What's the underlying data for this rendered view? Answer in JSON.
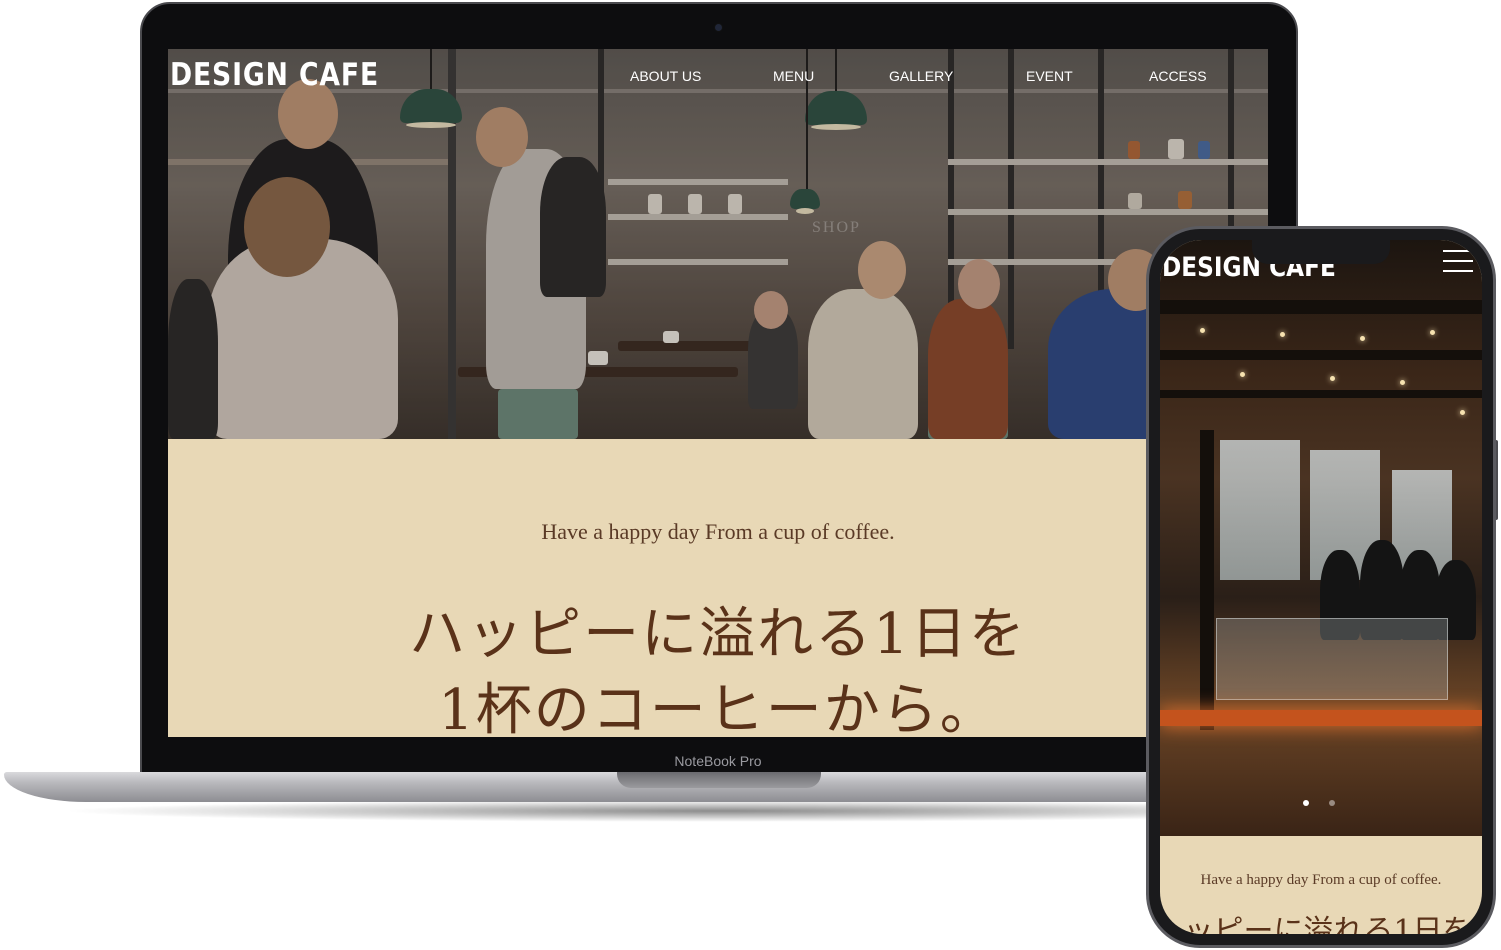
{
  "desktop": {
    "logo": "DESIGN CAFE",
    "nav": [
      {
        "label": "ABOUT US"
      },
      {
        "label": "MENU"
      },
      {
        "label": "GALLERY"
      },
      {
        "label": "EVENT"
      },
      {
        "label": "ACCESS"
      }
    ],
    "hero_sign": "SHOP",
    "tagline": "Have a happy day From a cup of coffee.",
    "headline_line1": "ハッピーに溢れる1日を",
    "headline_line2": "1杯のコーヒーから。"
  },
  "device": {
    "brand_label": "NoteBook Pro"
  },
  "mobile": {
    "logo": "DESIGN CAFE",
    "tagline": "Have a happy day From a cup of coffee.",
    "headline_partial": "ッピーに溢れる1日を",
    "slider": {
      "count": 2,
      "active_index": 0
    }
  },
  "colors": {
    "cream_bg": "#e8d8b6",
    "brown_text": "#5a3219"
  },
  "icons": {
    "menu": "hamburger-menu-icon"
  }
}
